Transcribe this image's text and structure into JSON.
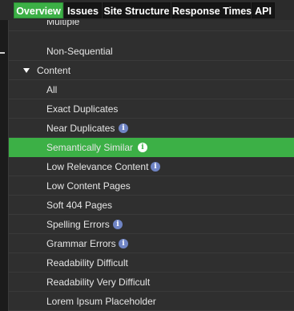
{
  "tabs": [
    {
      "label": "Overview",
      "active": true
    },
    {
      "label": "Issues",
      "active": false
    },
    {
      "label": "Site Structure",
      "active": false
    },
    {
      "label": "Response Times",
      "active": false
    },
    {
      "label": "API",
      "active": false
    }
  ],
  "tree": {
    "partial_top_item": "Multiple",
    "above_items": [
      "Non-Sequential"
    ],
    "group": {
      "label": "Content",
      "expanded": true
    },
    "items": [
      {
        "label": "All",
        "info": false
      },
      {
        "label": "Exact Duplicates",
        "info": false
      },
      {
        "label": "Near Duplicates",
        "info": true
      },
      {
        "label": "Semantically Similar",
        "info": true,
        "selected": true
      },
      {
        "label": "Low Relevance Content",
        "info": true
      },
      {
        "label": "Low Content Pages",
        "info": false
      },
      {
        "label": "Soft 404 Pages",
        "info": false
      },
      {
        "label": "Spelling Errors",
        "info": true
      },
      {
        "label": "Grammar Errors",
        "info": true
      },
      {
        "label": "Readability Difficult",
        "info": false
      },
      {
        "label": "Readability Very Difficult",
        "info": false
      },
      {
        "label": "Lorem Ipsum Placeholder",
        "info": false
      }
    ],
    "info_glyph": "i"
  },
  "colors": {
    "accent_green": "#3cb046",
    "info_blue": "#6f84c4",
    "background": "#2f2f2f"
  },
  "icons": {
    "info": "info-icon",
    "expand": "caret-down-icon"
  }
}
